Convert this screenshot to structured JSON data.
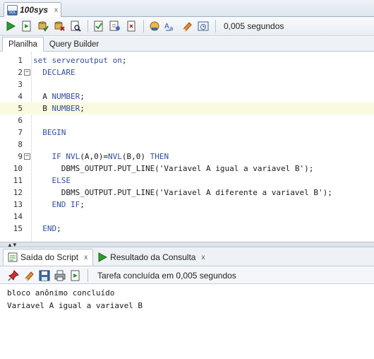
{
  "document_tab": {
    "title": "100sys",
    "close": "x"
  },
  "toolbar": {
    "icons": [
      "run-statement-icon",
      "run-script-icon",
      "commit-icon",
      "rollback-icon",
      "explain-plan-icon",
      "autotrace-icon",
      "sql-tuning-icon",
      "clear-icon",
      "format-icon",
      "eraser-icon",
      "history-icon"
    ],
    "elapsed": "0,005 segundos"
  },
  "sub_tabs": [
    "Planilha",
    "Query Builder"
  ],
  "editor": {
    "current_line": 5,
    "lines": [
      {
        "n": "1",
        "text": "set serveroutput on;",
        "fold": false
      },
      {
        "n": "2",
        "text": "  DECLARE",
        "fold": true
      },
      {
        "n": "3",
        "text": "",
        "fold": false
      },
      {
        "n": "4",
        "text": "  A NUMBER;",
        "fold": false
      },
      {
        "n": "5",
        "text": "  B NUMBER;",
        "fold": false
      },
      {
        "n": "6",
        "text": "",
        "fold": false
      },
      {
        "n": "7",
        "text": "  BEGIN",
        "fold": false
      },
      {
        "n": "8",
        "text": "",
        "fold": false
      },
      {
        "n": "9",
        "text": "    IF NVL(A,0)=NVL(B,0) THEN",
        "fold": true
      },
      {
        "n": "10",
        "text": "      DBMS_OUTPUT.PUT_LINE('Variavel A igual a variavel B');",
        "fold": false
      },
      {
        "n": "11",
        "text": "    ELSE",
        "fold": false
      },
      {
        "n": "12",
        "text": "      DBMS_OUTPUT.PUT_LINE('Variavel A diferente a variavel B');",
        "fold": false
      },
      {
        "n": "13",
        "text": "    END IF;",
        "fold": false
      },
      {
        "n": "14",
        "text": "",
        "fold": false
      },
      {
        "n": "15",
        "text": "  END;",
        "fold": false
      }
    ]
  },
  "results": {
    "tabs": [
      {
        "label": "Saída do Script",
        "icon": "script-output-icon",
        "close": "x"
      },
      {
        "label": "Resultado da Consulta",
        "icon": "query-result-icon",
        "close": "x"
      }
    ],
    "toolbar_status": "Tarefa concluída em 0,005 segundos",
    "output_lines": [
      "bloco anônimo concluído",
      "Variavel A igual a variavel B"
    ]
  }
}
